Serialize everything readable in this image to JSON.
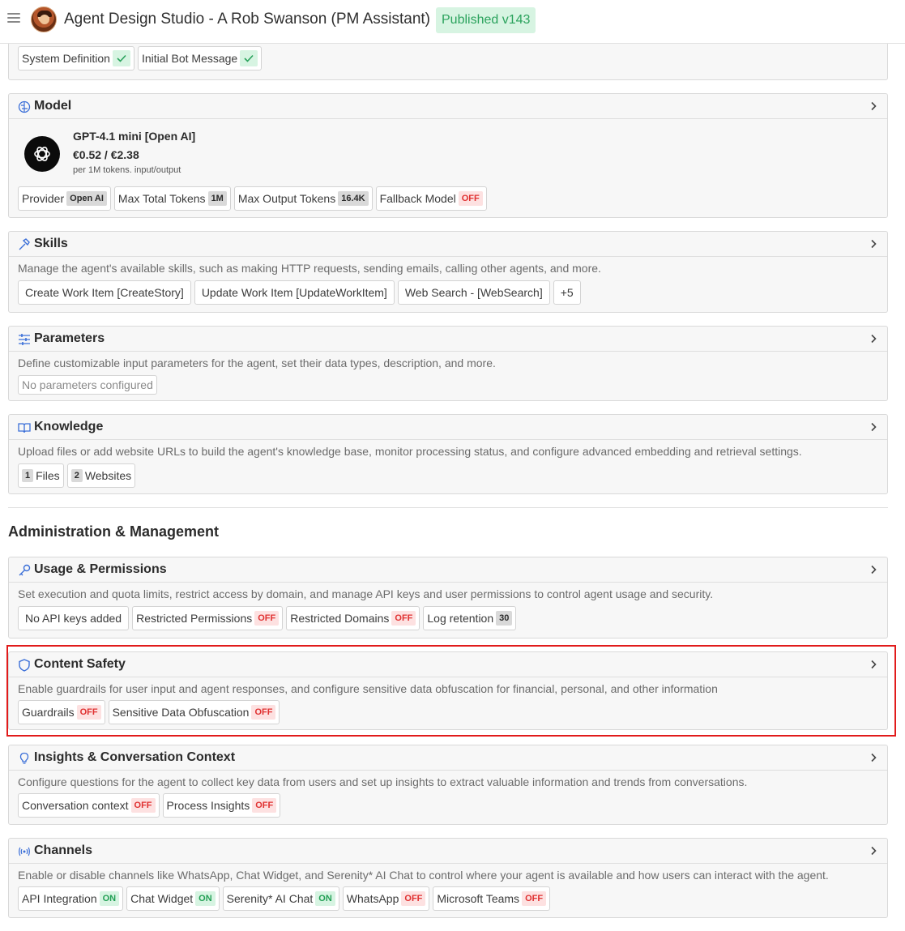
{
  "header": {
    "title": "Agent Design Studio - A Rob Swanson (PM Assistant)",
    "status": "Published v143"
  },
  "top_chips": [
    {
      "label": "System Definition"
    },
    {
      "label": "Initial Bot Message"
    }
  ],
  "model": {
    "title": "Model",
    "name": "GPT-4.1 mini [Open AI]",
    "price": "€0.52 / €2.38",
    "price_note": "per 1M tokens. input/output",
    "chips": [
      {
        "label": "Provider",
        "badge": "Open AI"
      },
      {
        "label": "Max Total Tokens",
        "badge": "1M"
      },
      {
        "label": "Max Output Tokens",
        "badge": "16.4K"
      },
      {
        "label": "Fallback Model",
        "badge": "OFF"
      }
    ]
  },
  "skills": {
    "title": "Skills",
    "description": "Manage the agent's available skills, such as making HTTP requests, sending emails, calling other agents, and more.",
    "chips": [
      "Create Work Item [CreateStory]",
      "Update Work Item [UpdateWorkItem]",
      "Web Search - [WebSearch]",
      "+5"
    ]
  },
  "parameters": {
    "title": "Parameters",
    "description": "Define customizable input parameters for the agent, set their data types, description, and more.",
    "empty_label": "No parameters configured"
  },
  "knowledge": {
    "title": "Knowledge",
    "description": "Upload files or add website URLs to build the agent's knowledge base, monitor processing status, and configure advanced embedding and retrieval settings.",
    "chips": [
      {
        "count": "1",
        "label": "Files"
      },
      {
        "count": "2",
        "label": "Websites"
      }
    ]
  },
  "admin_section_title": "Administration & Management",
  "usage": {
    "title": "Usage & Permissions",
    "description": "Set execution and quota limits, restrict access by domain, and manage API keys and user permissions to control agent usage and security.",
    "chips": [
      {
        "label": "No API keys added",
        "badge": ""
      },
      {
        "label": "Restricted Permissions",
        "badge": "OFF"
      },
      {
        "label": "Restricted Domains",
        "badge": "OFF"
      },
      {
        "label": "Log retention",
        "badge": "30"
      }
    ]
  },
  "content_safety": {
    "title": "Content Safety",
    "description": "Enable guardrails for user input and agent responses, and configure sensitive data obfuscation for financial, personal, and other information",
    "chips": [
      {
        "label": "Guardrails",
        "badge": "OFF"
      },
      {
        "label": "Sensitive Data Obfuscation",
        "badge": "OFF"
      }
    ]
  },
  "insights": {
    "title": "Insights & Conversation Context",
    "description": "Configure questions for the agent to collect key data from users and set up insights to extract valuable information and trends from conversations.",
    "chips": [
      {
        "label": "Conversation context",
        "badge": "OFF"
      },
      {
        "label": "Process Insights",
        "badge": "OFF"
      }
    ]
  },
  "channels": {
    "title": "Channels",
    "description": "Enable or disable channels like WhatsApp, Chat Widget, and Serenity* AI Chat to control where your agent is available and how users can interact with the agent.",
    "chips": [
      {
        "label": "API Integration",
        "badge": "ON"
      },
      {
        "label": "Chat Widget",
        "badge": "ON"
      },
      {
        "label": "Serenity* AI Chat",
        "badge": "ON"
      },
      {
        "label": "WhatsApp",
        "badge": "OFF"
      },
      {
        "label": "Microsoft Teams",
        "badge": "OFF"
      }
    ]
  }
}
